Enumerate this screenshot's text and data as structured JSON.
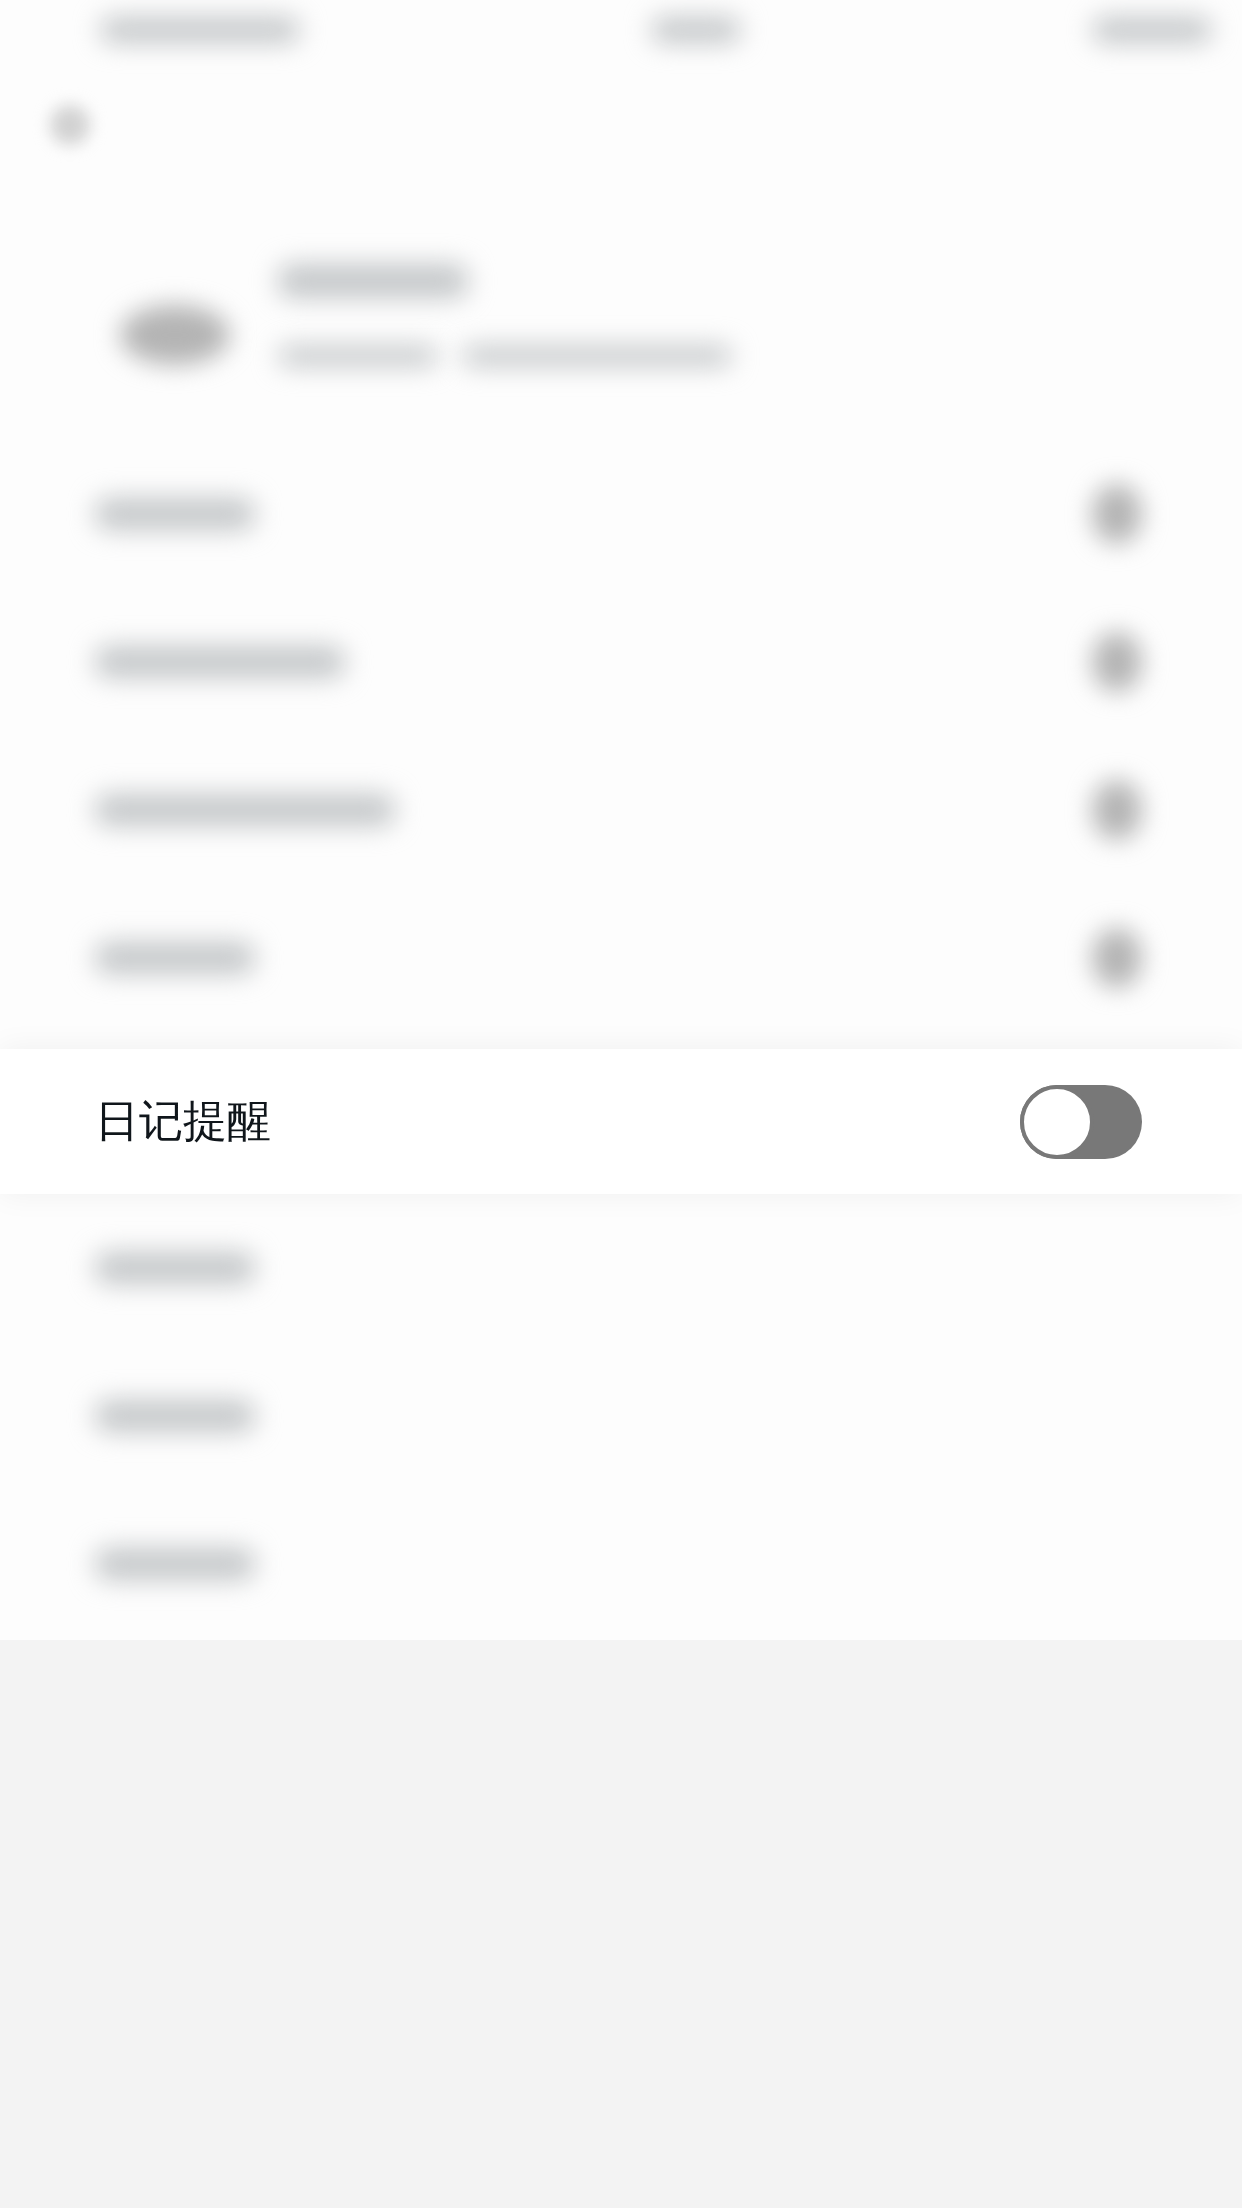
{
  "reminder": {
    "label": "日记提醒",
    "on": false
  }
}
